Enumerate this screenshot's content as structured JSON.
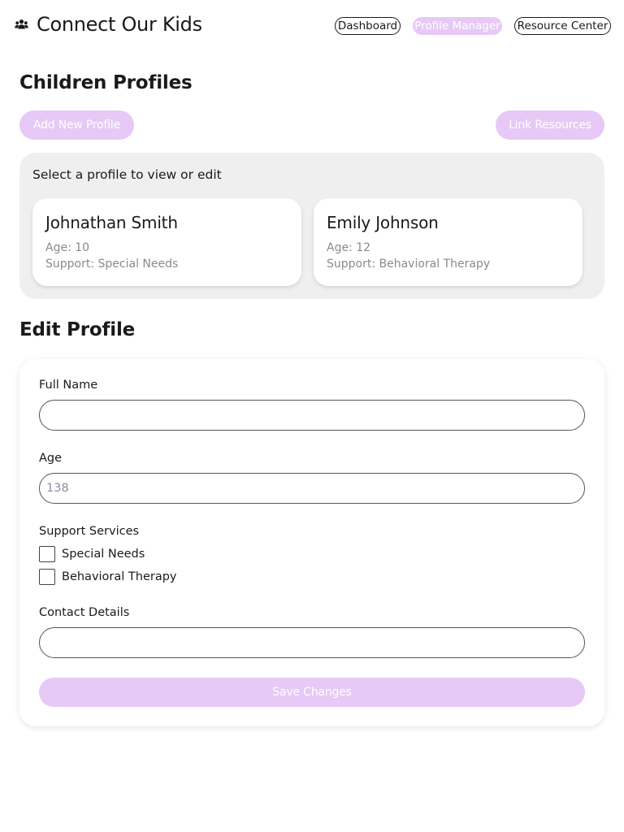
{
  "header": {
    "brand_icon": "users-icon",
    "title": "Connect Our Kids",
    "nav": [
      {
        "label": "Dashboard",
        "active": false
      },
      {
        "label": "Profile Manager",
        "active": true
      },
      {
        "label": "Resource Center",
        "active": false
      }
    ]
  },
  "profiles": {
    "title": "Children Profiles",
    "add_button": "Add New Profile",
    "link_button": "Link Resources",
    "hint": "Select a profile to view or edit",
    "cards": [
      {
        "name": "Johnathan Smith",
        "age": "Age: 10",
        "support": "Support: Special Needs"
      },
      {
        "name": "Emily Johnson",
        "age": "Age: 12",
        "support": "Support: Behavioral Therapy"
      }
    ]
  },
  "edit": {
    "title": "Edit Profile",
    "full_name_label": "Full Name",
    "full_name_value": "",
    "age_label": "Age",
    "age_value": "",
    "age_placeholder": "138",
    "support_label": "Support Services",
    "support_options": [
      {
        "label": "Special Needs",
        "checked": false
      },
      {
        "label": "Behavioral Therapy",
        "checked": false
      }
    ],
    "contact_label": "Contact Details",
    "contact_value": "",
    "save_button": "Save Changes"
  },
  "colors": {
    "accent": "#e7c9f7",
    "panel": "#efefef",
    "muted_text": "#8a8a8a"
  }
}
